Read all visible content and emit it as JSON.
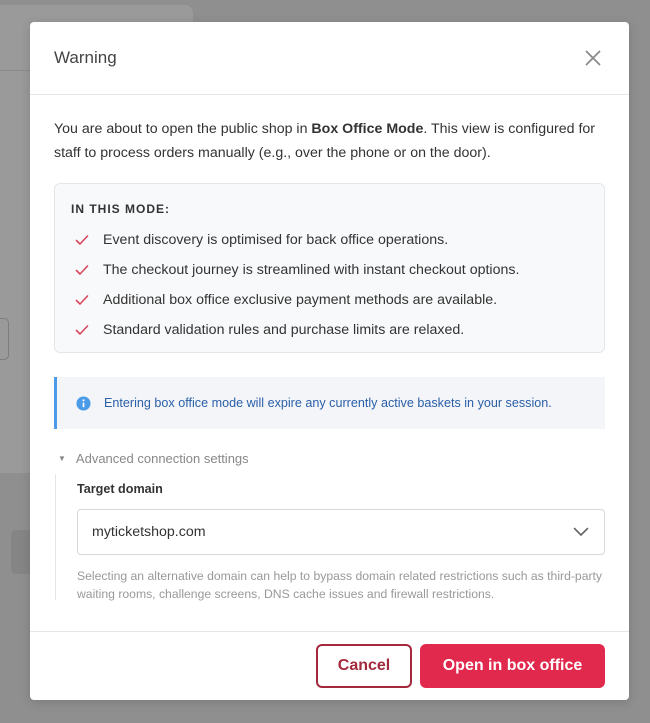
{
  "modal": {
    "title": "Warning",
    "intro_prefix": "You are about to open the public shop in ",
    "intro_bold": "Box Office Mode",
    "intro_suffix": ". This view is configured for staff to process orders manually (e.g., over the phone or on the door).",
    "mode_heading": "IN THIS MODE:",
    "mode_items": [
      "Event discovery is optimised for back office operations.",
      "The checkout journey is streamlined with instant checkout options.",
      "Additional box office exclusive payment methods are available.",
      "Standard validation rules and purchase limits are relaxed."
    ],
    "info_text": "Entering box office mode will expire any currently active baskets in your session.",
    "advanced_label": "Advanced connection settings",
    "target_domain_label": "Target domain",
    "target_domain_value": "myticketshop.com",
    "help_text": "Selecting an alternative domain can help to bypass domain related restrictions such as third-party waiting rooms, challenge screens, DNS cache issues and firewall restrictions.",
    "cancel_label": "Cancel",
    "primary_label": "Open in box office"
  },
  "icons": {
    "close": "close-icon",
    "check": "check-icon",
    "info": "info-icon",
    "caret": "caret-down-icon",
    "chevron": "chevron-down-icon"
  },
  "colors": {
    "accent": "#e0294c",
    "cancel_border": "#a22a3c",
    "check": "#d9485f",
    "info": "#4c9be8"
  }
}
